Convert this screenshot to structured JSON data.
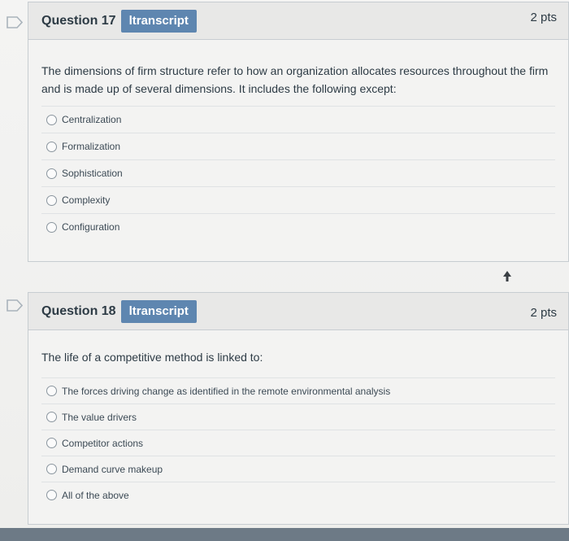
{
  "questions": [
    {
      "title": "Question 17",
      "transcript_label": "ltranscript",
      "points": "2 pts",
      "text": "The dimensions of firm structure refer to how an organization allocates resources throughout the firm and is made up of several dimensions. It includes the following except:",
      "answers": [
        "Centralization",
        "Formalization",
        "Sophistication",
        "Complexity",
        "Configuration"
      ]
    },
    {
      "title": "Question 18",
      "transcript_label": "ltranscript",
      "points": "2 pts",
      "text": "The life of a competitive method is linked to:",
      "answers": [
        "The forces driving change as identified in the remote environmental analysis",
        "The value drivers",
        "Competitor actions",
        "Demand curve makeup",
        "All of the above"
      ]
    }
  ],
  "colors": {
    "transcript_bg": "#5e86b0",
    "flag": "#a9b3bb"
  }
}
